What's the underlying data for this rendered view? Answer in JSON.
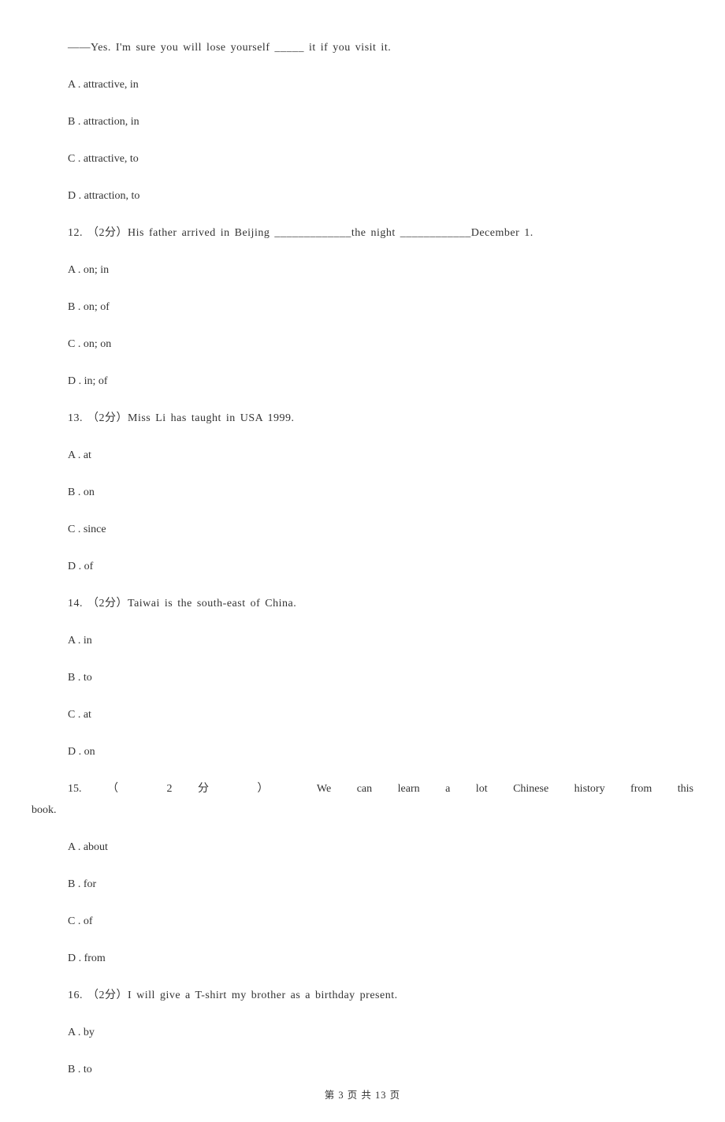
{
  "q11": {
    "continuation": "——Yes. I'm sure you will lose yourself _____ it if you visit it.",
    "options": {
      "a": "A . attractive, in",
      "b": "B . attraction, in",
      "c": "C . attractive, to",
      "d": "D . attraction, to"
    }
  },
  "q12": {
    "text": "12. （2分）His father arrived in Beijing _____________the night ____________December 1.",
    "options": {
      "a": "A . on; in",
      "b": "B . on; of",
      "c": "C . on; on",
      "d": "D . in; of"
    }
  },
  "q13": {
    "text": "13. （2分）Miss Li has taught in USA               1999.",
    "options": {
      "a": "A . at",
      "b": "B . on",
      "c": "C . since",
      "d": "D . of"
    }
  },
  "q14": {
    "text": "14. （2分）Taiwai is           the south-east of China.",
    "options": {
      "a": "A . in",
      "b": "B . to",
      "c": "C . at",
      "d": "D . on"
    }
  },
  "q15": {
    "text_part1": "15.  （ 2 分 ） We  can  learn  a  lot                     Chinese  history  from  this",
    "text_part2": "book.",
    "options": {
      "a": "A . about",
      "b": "B . for",
      "c": "C . of",
      "d": "D . from"
    }
  },
  "q16": {
    "text": "16. （2分）I will give a T-shirt        my brother as a birthday present.",
    "options": {
      "a": "A . by",
      "b": "B . to"
    }
  },
  "footer": "第 3 页 共 13 页"
}
